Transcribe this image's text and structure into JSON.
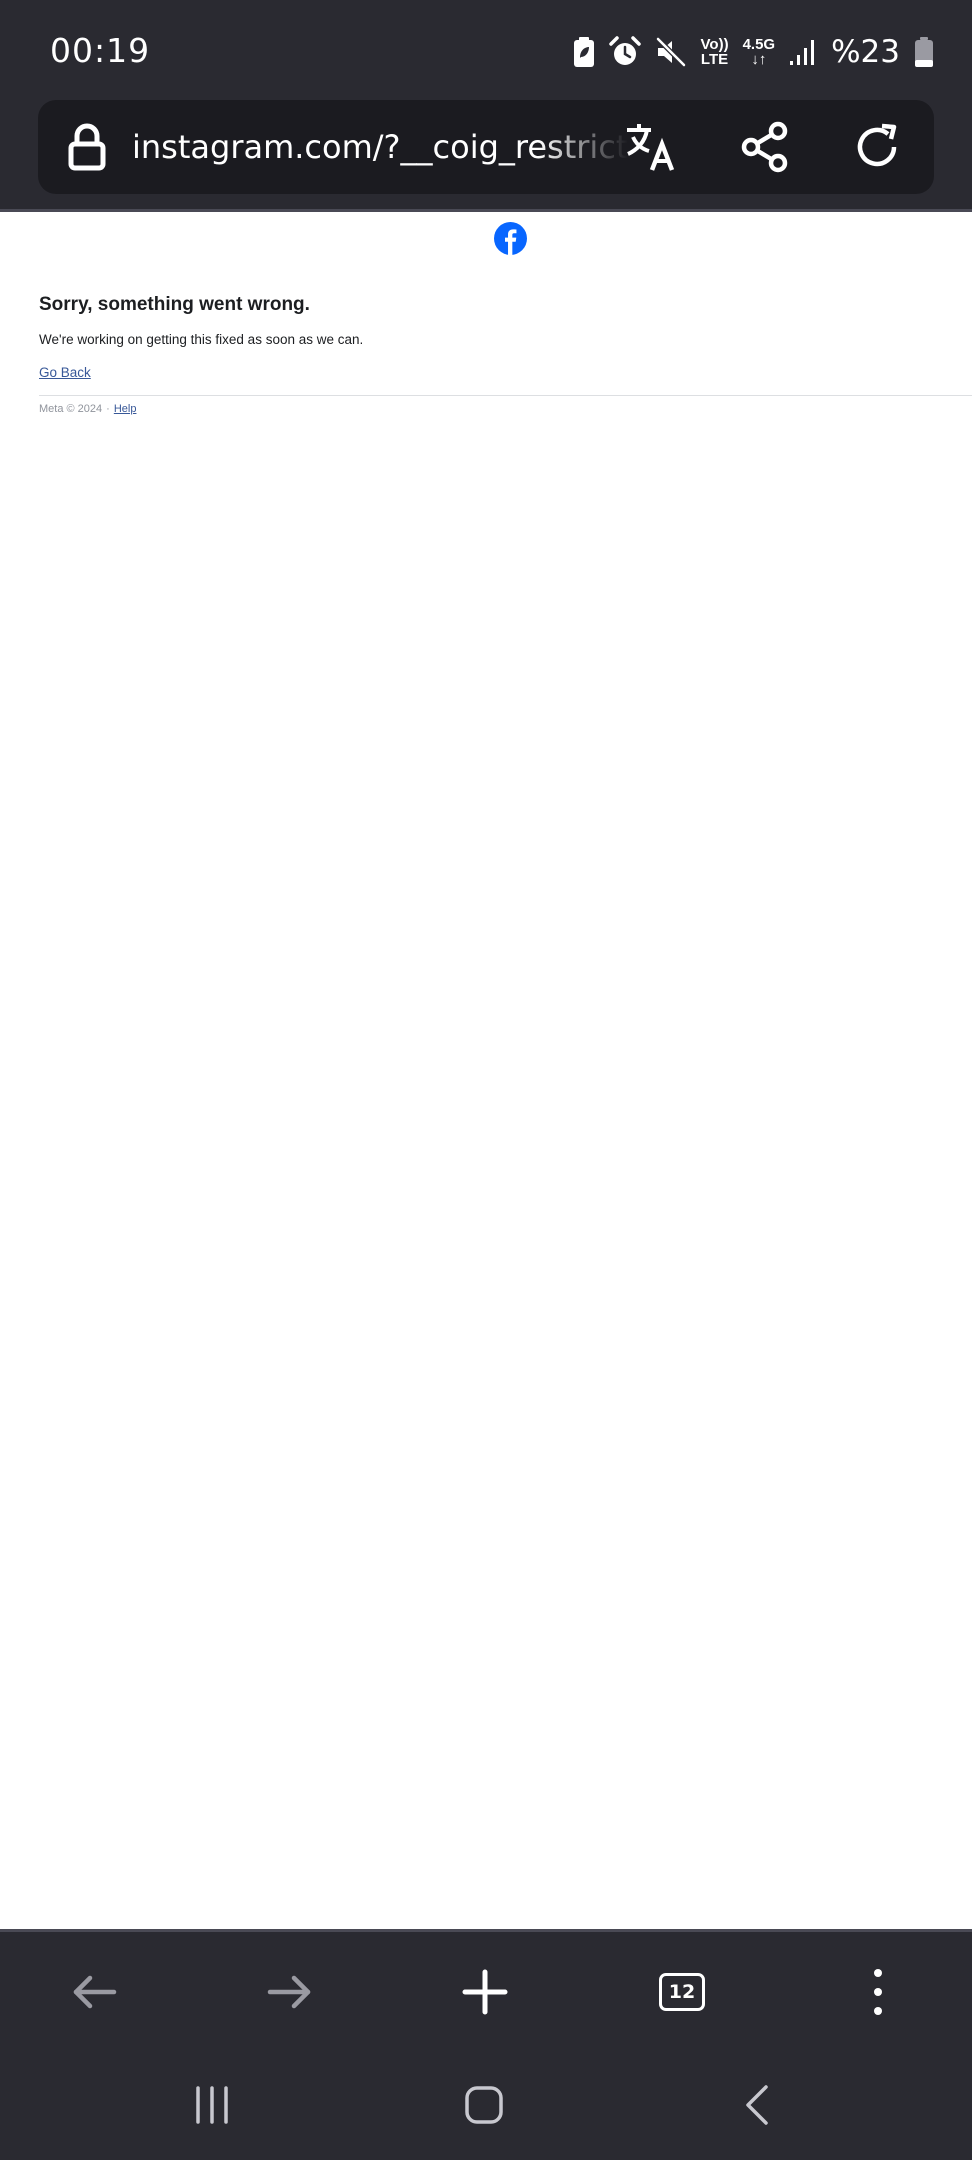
{
  "status_bar": {
    "time": "00:19",
    "network_top": "Vo))",
    "network_bottom": "LTE",
    "data_type": "4.5G",
    "data_arrows": "↓↑",
    "battery_text": "%23",
    "icons": [
      "battery-saver-icon",
      "alarm-icon",
      "mute-icon",
      "signal-icon",
      "battery-icon"
    ]
  },
  "url_bar": {
    "url": "instagram.com/?__coig_restricted",
    "icons": [
      "lock-icon",
      "translate-icon",
      "share-icon",
      "reload-icon"
    ]
  },
  "page": {
    "logo": "facebook-logo-icon",
    "brand_color": "#0866ff",
    "title": "Sorry, something went wrong.",
    "description": "We're working on getting this fixed as soon as we can.",
    "go_back_label": "Go Back",
    "footer_copyright": "Meta © 2024",
    "footer_separator": "·",
    "footer_help": "Help",
    "link_color": "#385898"
  },
  "toolbar": {
    "tab_count": "12",
    "icons": [
      "back-arrow-icon",
      "forward-arrow-icon",
      "plus-icon",
      "tabs-icon",
      "more-vertical-icon"
    ]
  },
  "nav_bar": {
    "icons": [
      "recents-icon",
      "home-icon",
      "back-chevron-icon"
    ]
  },
  "colors": {
    "chrome_background": "#2a2a31",
    "url_field_background": "#1b1b20",
    "page_background": "#ffffff",
    "disabled_icon": "#9a9aa2"
  }
}
